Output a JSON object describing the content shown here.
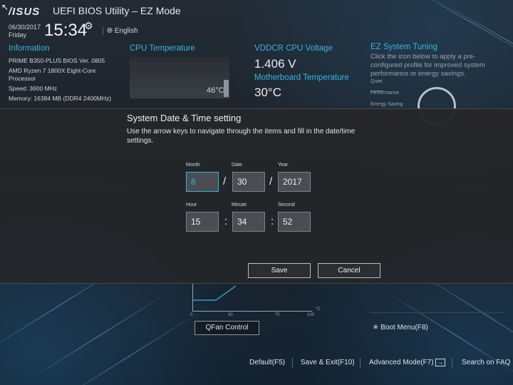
{
  "header": {
    "brand": "/ISUS",
    "app_title": "UEFI BIOS Utility – EZ Mode",
    "date": "06/30/2017",
    "weekday": "Friday",
    "time": "15:34",
    "language": "English"
  },
  "information": {
    "title": "Information",
    "board": "PRIME B350-PLUS   BIOS Ver. 0805",
    "cpu_line1": "AMD Ryzen 7 1800X Eight-Core",
    "cpu_line2": "Processor",
    "speed": "Speed: 3600 MHz",
    "memory": "Memory: 16384 MB (DDR4 2400MHz)"
  },
  "cpu_temperature": {
    "title": "CPU Temperature",
    "value": "46°C"
  },
  "voltage": {
    "title": "VDDCR CPU Voltage",
    "value": "1.406 V"
  },
  "mb_temperature": {
    "title": "Motherboard Temperature",
    "value": "30°C"
  },
  "ez_tuning": {
    "title": "EZ System Tuning",
    "description": "Click the icon below to apply a pre-configured profile for improved system performance or energy savings.",
    "options": [
      "Quiet",
      "Performance",
      "Energy Saving"
    ]
  },
  "qfan": {
    "ticks": [
      "0",
      "30",
      "70",
      "100"
    ],
    "unit": "°C",
    "button_label": "QFan Control"
  },
  "boot_menu": {
    "label": "Boot Menu(F8)"
  },
  "bottom_bar": {
    "default": "Default(F5)",
    "save_exit": "Save & Exit(F10)",
    "advanced": "Advanced Mode(F7)",
    "search": "Search on FAQ"
  },
  "dialog": {
    "title": "System Date & Time setting",
    "description": "Use the arrow keys to navigate through the items and fill in the date/time settings.",
    "labels": {
      "month": "Month",
      "date": "Date",
      "year": "Year",
      "hour": "Hour",
      "minute": "Minute",
      "second": "Second"
    },
    "values": {
      "month": "6",
      "date": "30",
      "year": "2017",
      "hour": "15",
      "minute": "34",
      "second": "52"
    },
    "date_sep": "/",
    "time_sep": ":",
    "save_label": "Save",
    "cancel_label": "Cancel"
  },
  "colors": {
    "accent": "#33b6e0",
    "dialog_bg": "#242629",
    "field_bg": "#4a4d51"
  },
  "icons": [
    "gear-icon",
    "globe-icon",
    "speed-gauge-icon",
    "boot-menu-icon",
    "advanced-mode-icon",
    "mouse-cursor-icon"
  ]
}
